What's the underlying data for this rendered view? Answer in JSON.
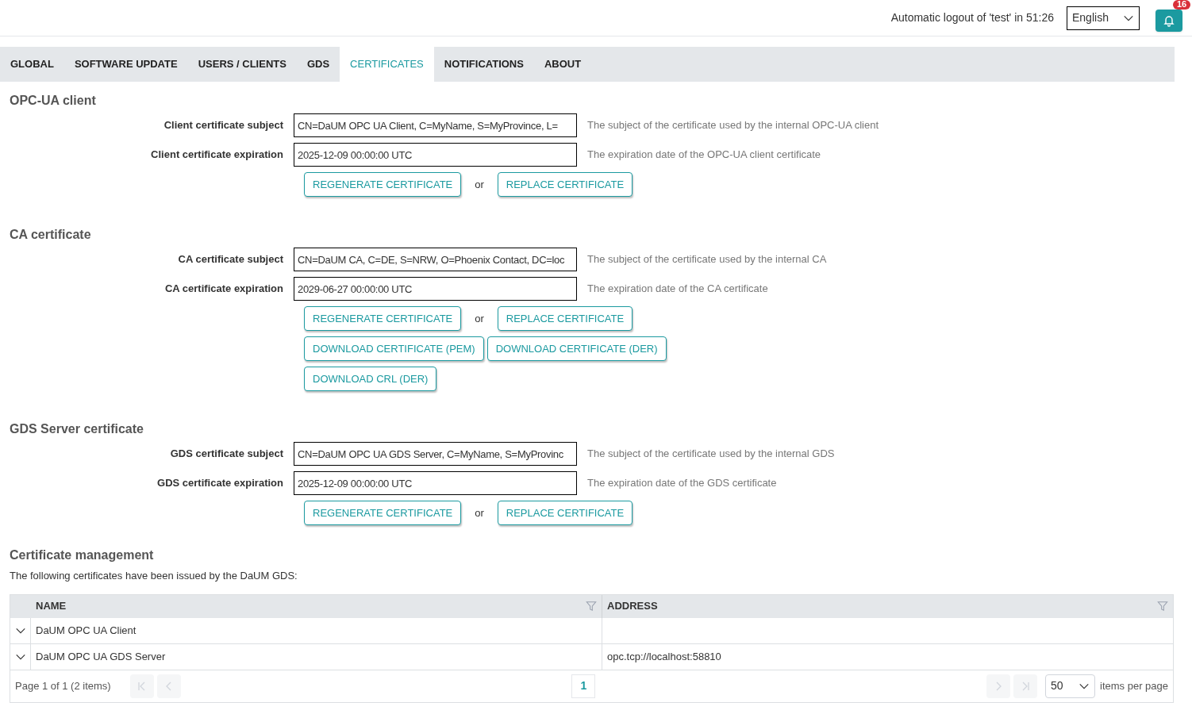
{
  "header": {
    "logout_text": "Automatic logout of 'test' in 51:26",
    "language": "English",
    "notification_count": "16"
  },
  "tabs": [
    {
      "label": "GLOBAL",
      "selected": false
    },
    {
      "label": "SOFTWARE UPDATE",
      "selected": false
    },
    {
      "label": "USERS / CLIENTS",
      "selected": false
    },
    {
      "label": "GDS",
      "selected": false
    },
    {
      "label": "CERTIFICATES",
      "selected": true
    },
    {
      "label": "NOTIFICATIONS",
      "selected": false
    },
    {
      "label": "ABOUT",
      "selected": false
    }
  ],
  "sections": [
    {
      "title": "OPC-UA client",
      "fields": [
        {
          "label": "Client certificate subject",
          "value": "CN=DaUM OPC UA Client, C=MyName, S=MyProvince, L=",
          "description": "The subject of the certificate used by the internal OPC-UA client"
        },
        {
          "label": "Client certificate expiration",
          "value": "2025-12-09 00:00:00 UTC",
          "description": "The expiration date of the OPC-UA client certificate"
        }
      ],
      "action_rows": [
        [
          {
            "kind": "button",
            "label": "REGENERATE CERTIFICATE"
          },
          {
            "kind": "text",
            "label": "or"
          },
          {
            "kind": "button",
            "label": "REPLACE CERTIFICATE"
          }
        ]
      ]
    },
    {
      "title": "CA certificate",
      "fields": [
        {
          "label": "CA certificate subject",
          "value": "CN=DaUM CA, C=DE, S=NRW, O=Phoenix Contact, DC=loc",
          "description": "The subject of the certificate used by the internal CA"
        },
        {
          "label": "CA certificate expiration",
          "value": "2029-06-27 00:00:00 UTC",
          "description": "The expiration date of the CA certificate"
        }
      ],
      "action_rows": [
        [
          {
            "kind": "button",
            "label": "REGENERATE CERTIFICATE"
          },
          {
            "kind": "text",
            "label": "or"
          },
          {
            "kind": "button",
            "label": "REPLACE CERTIFICATE"
          }
        ],
        [
          {
            "kind": "button",
            "label": "DOWNLOAD CERTIFICATE (PEM)"
          },
          {
            "kind": "button",
            "label": "DOWNLOAD CERTIFICATE (DER)"
          }
        ],
        [
          {
            "kind": "button",
            "label": "DOWNLOAD CRL (DER)"
          }
        ]
      ]
    },
    {
      "title": "GDS Server certificate",
      "fields": [
        {
          "label": "GDS certificate subject",
          "value": "CN=DaUM OPC UA GDS Server, C=MyName, S=MyProvinc",
          "description": "The subject of the certificate used by the internal GDS"
        },
        {
          "label": "GDS certificate expiration",
          "value": "2025-12-09 00:00:00 UTC",
          "description": "The expiration date of the GDS certificate"
        }
      ],
      "action_rows": [
        [
          {
            "kind": "button",
            "label": "REGENERATE CERTIFICATE"
          },
          {
            "kind": "text",
            "label": "or"
          },
          {
            "kind": "button",
            "label": "REPLACE CERTIFICATE"
          }
        ]
      ]
    }
  ],
  "management": {
    "title": "Certificate management",
    "intro": "The following certificates have been issued by the DaUM GDS:",
    "table": {
      "columns": [
        {
          "label": "NAME"
        },
        {
          "label": "ADDRESS"
        }
      ],
      "rows": [
        {
          "cells": [
            "DaUM OPC UA Client",
            ""
          ]
        },
        {
          "cells": [
            "DaUM OPC UA GDS Server",
            "opc.tcp://localhost:58810"
          ]
        }
      ]
    },
    "pager": {
      "info": "Page 1 of 1 (2 items)",
      "pages": [
        {
          "label": "1",
          "selected": true
        }
      ],
      "nav_buttons": [
        {
          "kind": "first",
          "disabled": true
        },
        {
          "kind": "prev",
          "disabled": true
        },
        {
          "kind": "next",
          "disabled": true
        },
        {
          "kind": "last",
          "disabled": true
        }
      ],
      "page_size": "50",
      "page_size_label": "items per page"
    }
  }
}
